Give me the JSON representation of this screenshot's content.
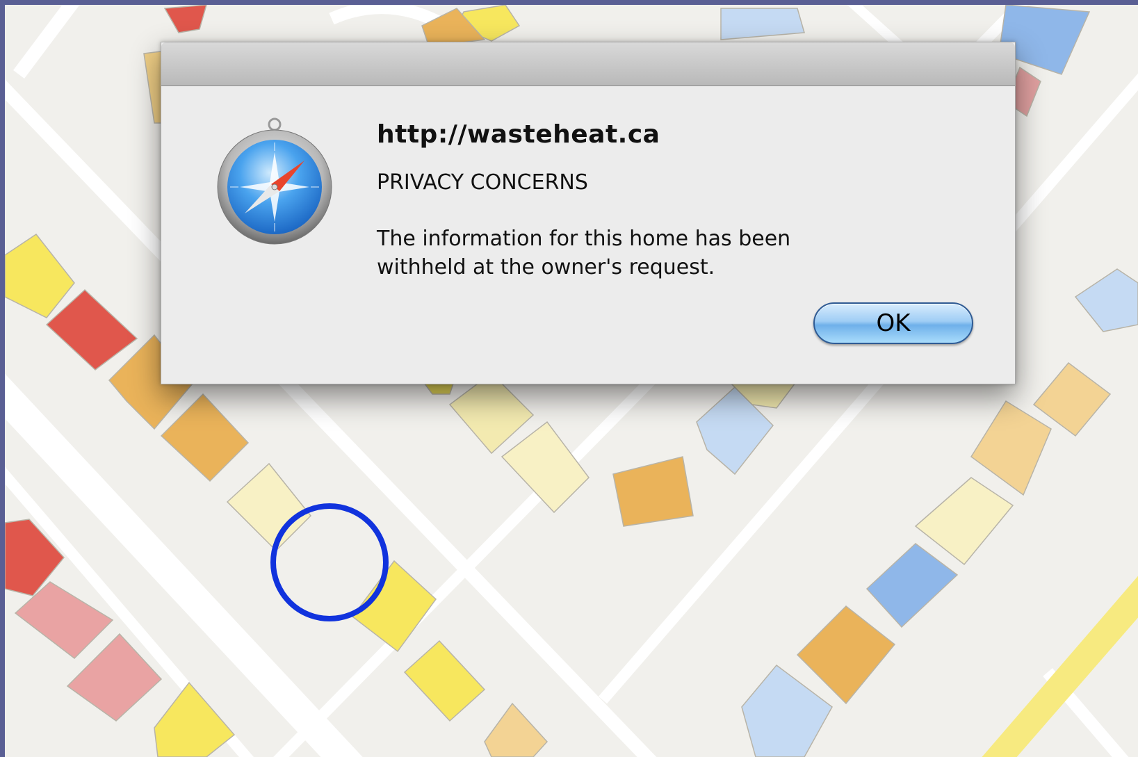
{
  "dialog": {
    "title": "http://wasteheat.ca",
    "subtitle": "PRIVACY CONCERNS",
    "message": "The information for this home has been withheld at the owner's request.",
    "ok_label": "OK",
    "icon": "compass-icon"
  },
  "map": {
    "highlight": "selected-home-circle",
    "colors": {
      "background": "#5a5f94",
      "ground": "#f1f0ec",
      "road": "#ffffff",
      "highlight_ring": "#1133dd",
      "red": "#e0574c",
      "pink": "#e9a3a3",
      "orange": "#eab35a",
      "light_orange": "#f3d394",
      "yellow": "#f7e75e",
      "cream": "#f8f1c5",
      "blue": "#8fb7e9",
      "light_blue": "#c5daf3"
    }
  }
}
